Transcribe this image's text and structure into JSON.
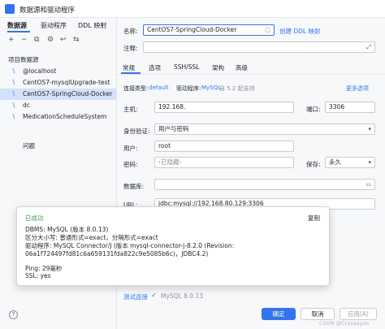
{
  "window": {
    "title": "数据源和驱动程序"
  },
  "left_tabs": [
    "数据源",
    "驱动程序",
    "DDL 映射"
  ],
  "left_toolbar": [
    "+",
    "−",
    "⧉",
    "⚙",
    "↩",
    "⇆"
  ],
  "section_label": "项目数据源",
  "datasources": [
    "@localhost",
    "CentOS7-mysqlUpgrade-test",
    "CentOS7-SpringCloud-Docker",
    "dc",
    "MedicationScheduleSystem"
  ],
  "problems_label": "问题",
  "form": {
    "name_label": "名称:",
    "name_value": "CentOS7-SpringCloud-Docker",
    "create_ddl_link": "创建 DDL 映射",
    "comment_label": "注释:",
    "tabs": [
      "常规",
      "选项",
      "SSH/SSL",
      "架构",
      "高级"
    ],
    "conn_type_label": "连接类型:",
    "conn_type_value": "default",
    "driver_label": "驱动程序:",
    "driver_value": "MySQL",
    "driver_version": "自 5.2 起支持",
    "more_options": "更多选项",
    "host_label": "主机:",
    "host_value": "192.168.",
    "port_label": "端口:",
    "port_value": "3306",
    "auth_label": "身份验证:",
    "auth_value": "用户与密码",
    "user_label": "用户:",
    "user_value": "root",
    "password_label": "密码:",
    "password_value": "‹已隐藏›",
    "save_label": "保存:",
    "save_value": "永久",
    "database_label": "数据库:",
    "url_label": "URL:",
    "url_value": "jdbc:mysql://192.168.80.129:3306"
  },
  "popup": {
    "status": "已成功",
    "copy": "复制",
    "lines": [
      "DBMS: MySQL (版本 8.0.13)",
      "区分大小写: 普通形式=exact，分隔形式=exact",
      "驱动程序: MySQL Connector/J (版本 mysql-connector-j-8.2.0 (Revision:",
      "06a1f724497fd81c6a659131fda822c9e5085b6c)，JDBC4.2)",
      "",
      "Ping: 29毫秒",
      "SSL: yes"
    ]
  },
  "test_connection": {
    "label": "测试连接",
    "check": "✓",
    "result": "MySQL 8.0.13"
  },
  "buttons": {
    "ok": "确定",
    "cancel": "取消",
    "apply": "应用(A)"
  },
  "watermark": "CSDN @Crazaayoo",
  "colors": {
    "accent": "#3574f0",
    "success": "#3f9a4c",
    "selection": "#d4e2fb"
  }
}
